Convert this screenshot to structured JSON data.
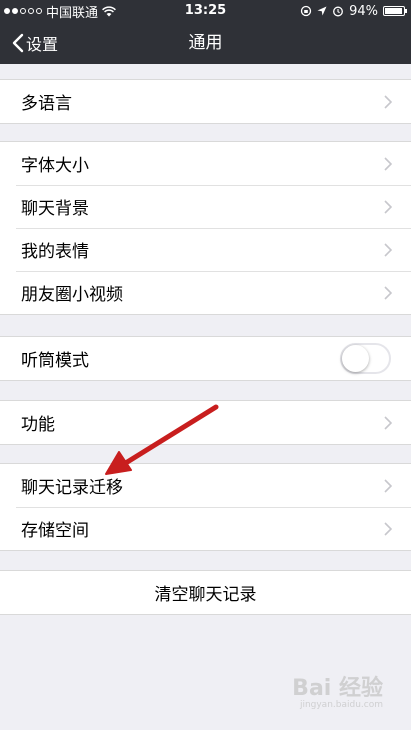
{
  "status_bar": {
    "carrier": "中国联通",
    "time": "13:25",
    "battery_percent": "94%",
    "battery_level": 0.94
  },
  "nav": {
    "back_label": "设置",
    "title": "通用"
  },
  "groups": [
    {
      "items": [
        {
          "label": "多语言",
          "icon": "chevron-right-icon"
        }
      ]
    },
    {
      "items": [
        {
          "label": "字体大小",
          "icon": "chevron-right-icon"
        },
        {
          "label": "聊天背景",
          "icon": "chevron-right-icon"
        },
        {
          "label": "我的表情",
          "icon": "chevron-right-icon"
        },
        {
          "label": "朋友圈小视频",
          "icon": "chevron-right-icon"
        }
      ]
    },
    {
      "items": [
        {
          "label": "听筒模式",
          "toggle": false
        }
      ]
    },
    {
      "items": [
        {
          "label": "功能",
          "icon": "chevron-right-icon"
        }
      ]
    },
    {
      "items": [
        {
          "label": "聊天记录迁移",
          "icon": "chevron-right-icon"
        },
        {
          "label": "存储空间",
          "icon": "chevron-right-icon"
        }
      ]
    },
    {
      "items": [
        {
          "label": "清空聊天记录"
        }
      ]
    }
  ],
  "annotation": {
    "type": "arrow",
    "color": "#c81e1e"
  },
  "watermark": {
    "text": "Bai 经验",
    "sub": "jingyan.baidu.com"
  }
}
